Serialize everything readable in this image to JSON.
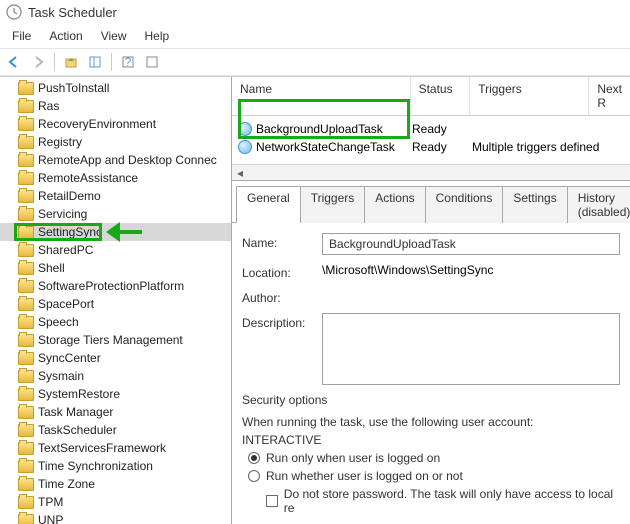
{
  "window": {
    "title": "Task Scheduler"
  },
  "menu": {
    "file": "File",
    "action": "Action",
    "view": "View",
    "help": "Help"
  },
  "tree": {
    "items": [
      {
        "label": "PushToInstall"
      },
      {
        "label": "Ras"
      },
      {
        "label": "RecoveryEnvironment"
      },
      {
        "label": "Registry"
      },
      {
        "label": "RemoteApp and Desktop Connec"
      },
      {
        "label": "RemoteAssistance"
      },
      {
        "label": "RetailDemo"
      },
      {
        "label": "Servicing"
      },
      {
        "label": "SettingSync",
        "selected": true
      },
      {
        "label": "SharedPC"
      },
      {
        "label": "Shell"
      },
      {
        "label": "SoftwareProtectionPlatform"
      },
      {
        "label": "SpacePort"
      },
      {
        "label": "Speech"
      },
      {
        "label": "Storage Tiers Management"
      },
      {
        "label": "SyncCenter"
      },
      {
        "label": "Sysmain"
      },
      {
        "label": "SystemRestore"
      },
      {
        "label": "Task Manager"
      },
      {
        "label": "TaskScheduler"
      },
      {
        "label": "TextServicesFramework"
      },
      {
        "label": "Time Synchronization"
      },
      {
        "label": "Time Zone"
      },
      {
        "label": "TPM"
      },
      {
        "label": "UNP"
      }
    ]
  },
  "tasklist": {
    "cols": {
      "name": "Name",
      "status": "Status",
      "triggers": "Triggers",
      "next": "Next R"
    },
    "rows": [
      {
        "name": "BackgroundUploadTask",
        "status": "Ready",
        "triggers": ""
      },
      {
        "name": "NetworkStateChangeTask",
        "status": "Ready",
        "triggers": "Multiple triggers defined"
      }
    ]
  },
  "tabs": {
    "general": "General",
    "triggers": "Triggers",
    "actions": "Actions",
    "conditions": "Conditions",
    "settings": "Settings",
    "history": "History (disabled)"
  },
  "form": {
    "name_label": "Name:",
    "name_value": "BackgroundUploadTask",
    "location_label": "Location:",
    "location_value": "\\Microsoft\\Windows\\SettingSync",
    "author_label": "Author:",
    "description_label": "Description:",
    "sec_header": "Security options",
    "sec_when": "When running the task, use the following user account:",
    "sec_account": "INTERACTIVE",
    "sec_opt1": "Run only when user is logged on",
    "sec_opt2": "Run whether user is logged on or not",
    "sec_chk": "Do not store password. The task will only have access to local re"
  }
}
